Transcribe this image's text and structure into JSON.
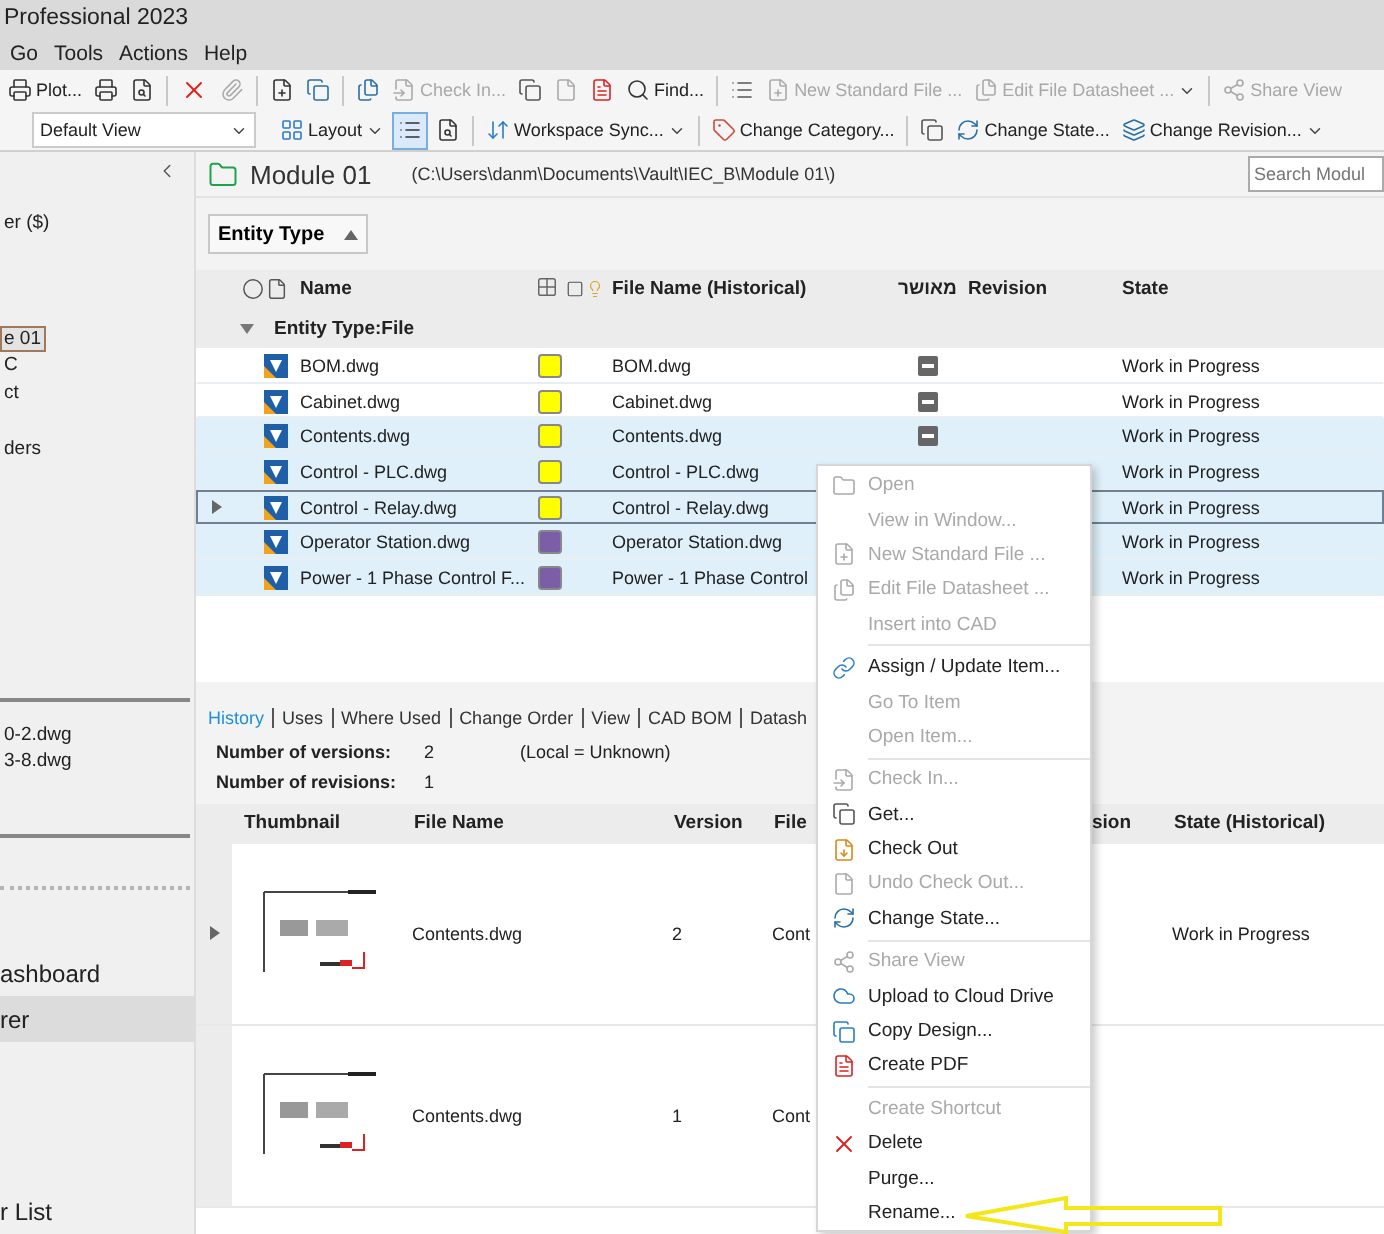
{
  "window": {
    "title": "Professional 2023"
  },
  "menu_bar": [
    "Go",
    "Tools",
    "Actions",
    "Help"
  ],
  "toolbar_1": [
    {
      "label": "Plot...",
      "disabled": false,
      "dropdown": false
    },
    {
      "label": "Check In...",
      "disabled": true,
      "dropdown": false
    },
    {
      "label": "Find...",
      "disabled": false,
      "dropdown": false
    },
    {
      "label": "New Standard File ...",
      "disabled": true,
      "dropdown": false
    },
    {
      "label": "Edit File Datasheet ...",
      "disabled": true,
      "dropdown": true
    },
    {
      "label": "Share View",
      "disabled": true,
      "dropdown": false
    }
  ],
  "toolbar_2": {
    "view": "Default View",
    "items": [
      {
        "label": "Layout",
        "disabled": false,
        "dropdown": true
      },
      {
        "label": "Workspace Sync...",
        "disabled": false,
        "dropdown": true
      },
      {
        "label": "Change Category...",
        "disabled": false,
        "dropdown": false
      },
      {
        "label": "Change State...",
        "disabled": false,
        "dropdown": false
      },
      {
        "label": "Change Revision...",
        "disabled": false,
        "dropdown": true
      }
    ]
  },
  "sidebar": {
    "tree": [
      {
        "label": "er ($)",
        "selected": false
      },
      {
        "label": "e 01",
        "selected": true
      },
      {
        "label": "C",
        "selected": false
      },
      {
        "label": "ct",
        "selected": false
      },
      {
        "label": "ders",
        "selected": false
      }
    ],
    "files": [
      "0-2.dwg",
      "3-8.dwg"
    ],
    "nav": [
      {
        "label": "ashboard",
        "selected": false
      },
      {
        "label": "rer",
        "selected": true
      },
      {
        "label": "r List",
        "selected": false
      }
    ]
  },
  "folder": {
    "name": "Module 01",
    "path": "(C:\\Users\\danm\\Documents\\Vault\\IEC_B\\Module 01\\)",
    "search": {
      "placeholder": "Search Modul"
    }
  },
  "group_by": "Entity Type",
  "columns": [
    "Name",
    "File Name (Historical)",
    "מאושר",
    "Revision",
    "State"
  ],
  "group": "Entity Type:File",
  "rows": [
    {
      "name": "BOM.dwg",
      "color": "#ffff00",
      "historical": "BOM.dwg",
      "approved_mark": true,
      "state": "Work in Progress",
      "selected": false,
      "focused": false
    },
    {
      "name": "Cabinet.dwg",
      "color": "#ffff00",
      "historical": "Cabinet.dwg",
      "approved_mark": true,
      "state": "Work in Progress",
      "selected": false,
      "focused": false
    },
    {
      "name": "Contents.dwg",
      "color": "#ffff00",
      "historical": "Contents.dwg",
      "approved_mark": true,
      "state": "Work in Progress",
      "selected": true,
      "focused": false
    },
    {
      "name": "Control - PLC.dwg",
      "color": "#ffff00",
      "historical": "Control - PLC.dwg",
      "state": "Work in Progress",
      "selected": true,
      "focused": false
    },
    {
      "name": "Control - Relay.dwg",
      "color": "#ffff00",
      "historical": "Control - Relay.dwg",
      "state": "Work in Progress",
      "selected": true,
      "focused": true
    },
    {
      "name": "Operator Station.dwg",
      "color": "#7b5ea7",
      "historical": "Operator Station.dwg",
      "state": "Work in Progress",
      "selected": true,
      "focused": false
    },
    {
      "name": "Power - 1 Phase Control F...",
      "color": "#7b5ea7",
      "historical": "Power - 1 Phase Control",
      "state": "Work in Progress",
      "selected": true,
      "focused": false
    }
  ],
  "detail_tabs": [
    {
      "label": "History",
      "selected": true
    },
    {
      "label": "Uses",
      "selected": false
    },
    {
      "label": "Where Used",
      "selected": false
    },
    {
      "label": "Change Order",
      "selected": false
    },
    {
      "label": "View",
      "selected": false
    },
    {
      "label": "CAD BOM",
      "selected": false
    },
    {
      "label": "Datash",
      "selected": false
    }
  ],
  "info": [
    {
      "label": "Number of versions:",
      "value": "2",
      "note": "(Local = Unknown)"
    },
    {
      "label": "Number of revisions:",
      "value": "1"
    }
  ],
  "history_columns": [
    "Thumbnail",
    "File Name",
    "Version",
    "File",
    "sion",
    "State (Historical)"
  ],
  "history_rows": [
    {
      "file_name": "Contents.dwg",
      "version": "2",
      "column_4": "Cont",
      "state": "Work in Progress",
      "expandable": true
    },
    {
      "file_name": "Contents.dwg",
      "version": "1",
      "column_4": "Cont",
      "expandable": false
    }
  ],
  "context_menu": [
    [
      {
        "label": "Open",
        "disabled": true
      },
      {
        "label": "View in Window...",
        "disabled": true
      },
      {
        "label": "New Standard File ...",
        "disabled": true
      },
      {
        "label": "Edit File Datasheet ...",
        "disabled": true
      },
      {
        "label": "Insert into CAD",
        "disabled": true
      }
    ],
    [
      {
        "label": "Assign / Update Item...",
        "disabled": false
      },
      {
        "label": "Go To Item",
        "disabled": true
      },
      {
        "label": "Open Item...",
        "disabled": true
      }
    ],
    [
      {
        "label": "Check In...",
        "disabled": true
      },
      {
        "label": "Get...",
        "disabled": false
      },
      {
        "label": "Check Out",
        "disabled": false
      },
      {
        "label": "Undo Check Out...",
        "disabled": true
      },
      {
        "label": "Change State...",
        "disabled": false
      }
    ],
    [
      {
        "label": "Share View",
        "disabled": true
      },
      {
        "label": "Upload to Cloud Drive",
        "disabled": false
      },
      {
        "label": "Copy Design...",
        "disabled": false
      },
      {
        "label": "Create PDF",
        "disabled": false
      }
    ],
    [
      {
        "label": "Create Shortcut",
        "disabled": true
      },
      {
        "label": "Delete",
        "disabled": false
      },
      {
        "label": "Purge...",
        "disabled": false
      },
      {
        "label": "Rename...",
        "disabled": false
      }
    ]
  ]
}
